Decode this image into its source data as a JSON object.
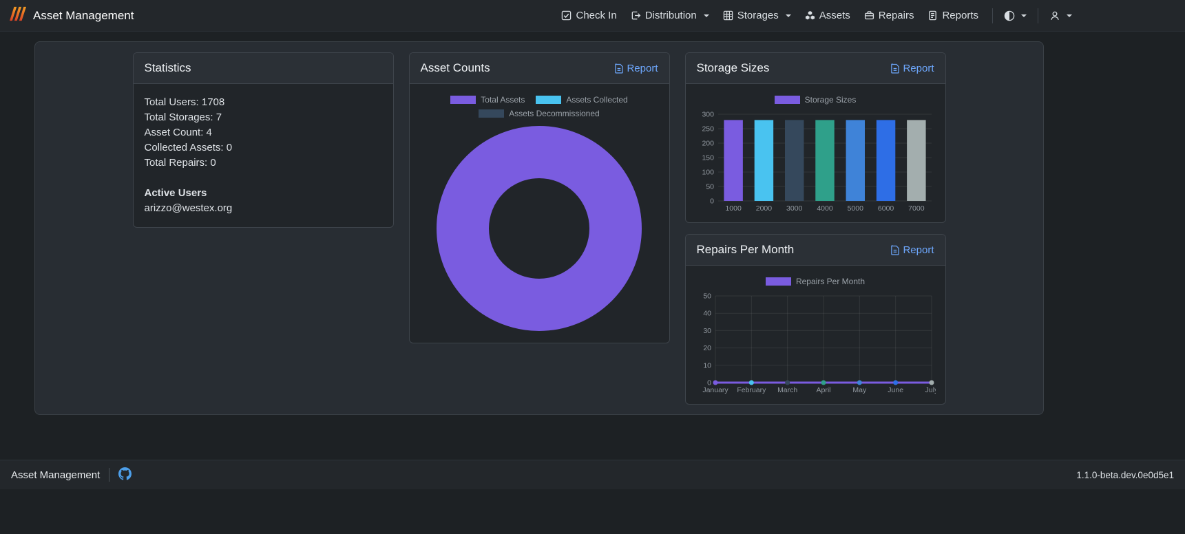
{
  "app": {
    "title": "Asset Management"
  },
  "navbar": {
    "brand": "Asset Management",
    "items": [
      {
        "label": "Check In",
        "icon": "check-square-icon",
        "dropdown": false
      },
      {
        "label": "Distribution",
        "icon": "box-arrow-right-icon",
        "dropdown": true
      },
      {
        "label": "Storages",
        "icon": "grid-icon",
        "dropdown": true
      },
      {
        "label": "Assets",
        "icon": "boxes-icon",
        "dropdown": false
      },
      {
        "label": "Repairs",
        "icon": "briefcase-icon",
        "dropdown": false
      },
      {
        "label": "Reports",
        "icon": "file-report-icon",
        "dropdown": false
      }
    ],
    "controls": [
      {
        "icon": "theme-half-circle-icon",
        "dropdown": true
      },
      {
        "icon": "user-person-icon",
        "dropdown": true
      }
    ]
  },
  "statistics": {
    "title": "Statistics",
    "stats": [
      "Total Users: 1708",
      "Total Storages: 7",
      "Asset Count: 4",
      "Collected Assets: 0",
      "Total Repairs: 0"
    ],
    "active_users_heading": "Active Users",
    "active_users": [
      "arizzo@westex.org"
    ]
  },
  "cards": {
    "asset_counts": {
      "title": "Asset Counts",
      "report_label": "Report"
    },
    "storage_sizes": {
      "title": "Storage Sizes",
      "report_label": "Report"
    },
    "repairs_per_month": {
      "title": "Repairs Per Month",
      "report_label": "Report"
    }
  },
  "footer": {
    "brand": "Asset Management",
    "version": "1.1.0-beta.dev.0e0d5e1"
  },
  "colors": {
    "accent_link": "#6ea8fe",
    "purple": "#7a5ce0",
    "cyan": "#49c3f0",
    "slate": "#35485c"
  },
  "chart_data": [
    {
      "id": "asset-counts",
      "type": "pie",
      "doughnut": true,
      "title": "Asset Counts",
      "labels": [
        "Total Assets",
        "Assets Collected",
        "Assets Decommissioned"
      ],
      "values": [
        4,
        0,
        0
      ],
      "colors": [
        "#7a5ce0",
        "#49c3f0",
        "#35485c"
      ],
      "legend_position": "top"
    },
    {
      "id": "storage-sizes",
      "type": "bar",
      "title": "Storage Sizes",
      "categories": [
        "1000",
        "2000",
        "3000",
        "4000",
        "5000",
        "6000",
        "7000"
      ],
      "values": [
        280,
        280,
        280,
        280,
        280,
        280,
        280
      ],
      "bar_colors": [
        "#7a5ce0",
        "#49c3f0",
        "#35485c",
        "#2fa08a",
        "#3f83d8",
        "#2e6ee6",
        "#a3aeae"
      ],
      "ylim": [
        0,
        300
      ],
      "ytick_step": 50,
      "grid": true,
      "legend": [
        {
          "label": "Storage Sizes",
          "color": "#7a5ce0"
        }
      ],
      "legend_position": "top"
    },
    {
      "id": "repairs-per-month",
      "type": "line",
      "title": "Repairs Per Month",
      "categories": [
        "January",
        "February",
        "March",
        "April",
        "May",
        "June",
        "July"
      ],
      "values": [
        0,
        0,
        0,
        0,
        0,
        0,
        0
      ],
      "line_color": "#7a5ce0",
      "point_colors": [
        "#7a5ce0",
        "#49c3f0",
        "#35485c",
        "#2fa08a",
        "#3f83d8",
        "#2e6ee6",
        "#a3aeae"
      ],
      "ylim": [
        0,
        50
      ],
      "ytick_step": 10,
      "grid": true,
      "legend": [
        {
          "label": "Repairs Per Month",
          "color": "#7a5ce0"
        }
      ],
      "legend_position": "top"
    }
  ]
}
